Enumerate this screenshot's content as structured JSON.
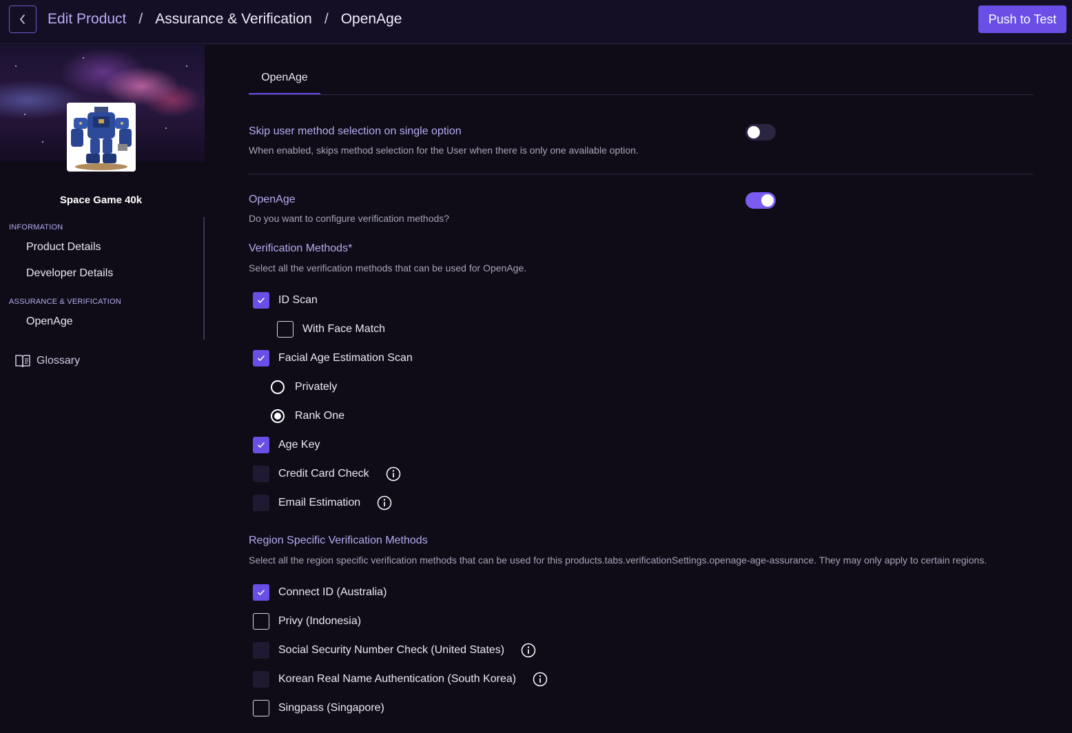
{
  "header": {
    "breadcrumb": [
      "Edit Product",
      "Assurance & Verification",
      "OpenAge"
    ],
    "separator": "/",
    "push_label": "Push to Test"
  },
  "sidebar": {
    "product_name": "Space Game 40k",
    "sections": [
      {
        "title": "INFORMATION",
        "items": [
          "Product Details",
          "Developer Details"
        ]
      },
      {
        "title": "ASSURANCE & VERIFICATION",
        "items": [
          "OpenAge"
        ]
      }
    ],
    "glossary_label": "Glossary"
  },
  "main": {
    "tab": "OpenAge",
    "skip": {
      "title": "Skip user method selection on single option",
      "desc": "When enabled, skips method selection for the User when there is only one available option.",
      "enabled": false
    },
    "openage": {
      "title": "OpenAge",
      "desc": "Do you want to configure verification methods?",
      "enabled": true
    },
    "methods": {
      "title": "Verification Methods*",
      "desc": "Select all the verification methods that can be used for OpenAge.",
      "options": [
        {
          "label": "ID Scan",
          "state": "checked"
        },
        {
          "label": "With Face Match",
          "state": "empty"
        },
        {
          "label": "Facial Age Estimation Scan",
          "state": "checked"
        },
        {
          "label": "Privately",
          "selected": false
        },
        {
          "label": "Rank One",
          "selected": true
        },
        {
          "label": "Age Key",
          "state": "checked"
        },
        {
          "label": "Credit Card Check",
          "state": "disabled"
        },
        {
          "label": "Email Estimation",
          "state": "disabled"
        }
      ]
    },
    "regions": {
      "title": "Region Specific Verification Methods",
      "desc": "Select all the region specific verification methods that can be used for this products.tabs.verificationSettings.openage-age-assurance. They may only apply to certain regions.",
      "options": [
        {
          "label": "Connect ID (Australia)",
          "state": "checked"
        },
        {
          "label": "Privy (Indonesia)",
          "state": "empty"
        },
        {
          "label": "Social Security Number Check (United States)",
          "state": "disabled"
        },
        {
          "label": "Korean Real Name Authentication (South Korea)",
          "state": "disabled"
        },
        {
          "label": "Singpass (Singapore)",
          "state": "empty"
        }
      ]
    }
  },
  "colors": {
    "accent": "#6a4ee6",
    "accent_text": "#b7acf0",
    "background": "#0f0c18",
    "topbar": "#150f26"
  }
}
